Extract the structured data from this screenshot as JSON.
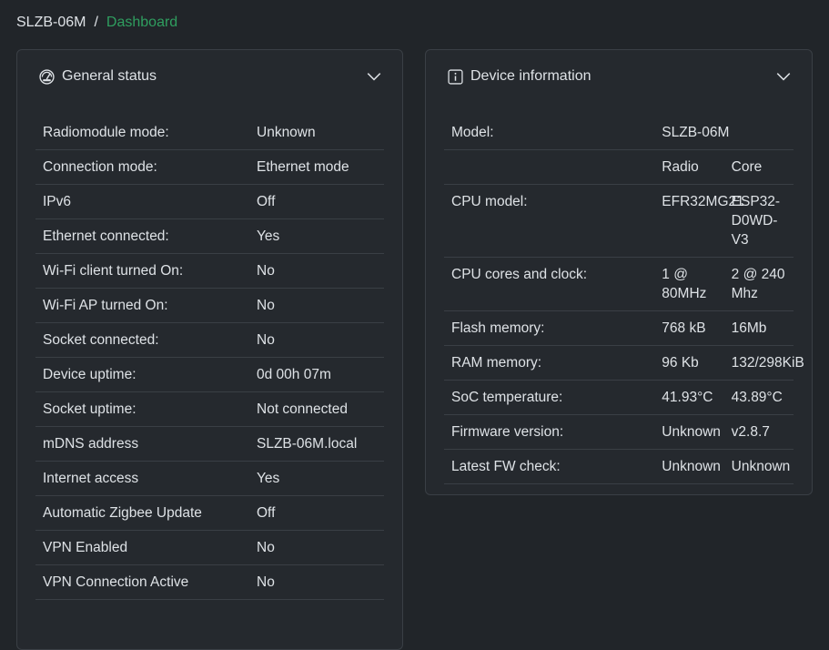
{
  "breadcrumb": {
    "device": "SLZB-06M",
    "separator": "/",
    "current": "Dashboard"
  },
  "general": {
    "title": "General status",
    "icon": "gauge-icon",
    "rows": [
      {
        "label": "Radiomodule mode:",
        "value": "Unknown"
      },
      {
        "label": "Connection mode:",
        "value": "Ethernet mode"
      },
      {
        "label": "IPv6",
        "value": "Off"
      },
      {
        "label": "Ethernet connected:",
        "value": "Yes"
      },
      {
        "label": "Wi-Fi client turned On:",
        "value": "No"
      },
      {
        "label": "Wi-Fi AP turned On:",
        "value": "No"
      },
      {
        "label": "Socket connected:",
        "value": "No"
      },
      {
        "label": "Device uptime:",
        "value": "0d 00h 07m"
      },
      {
        "label": "Socket uptime:",
        "value": "Not connected"
      },
      {
        "label": "mDNS address",
        "value": "SLZB-06M.local"
      },
      {
        "label": "Internet access",
        "value": "Yes"
      },
      {
        "label": "Automatic Zigbee Update",
        "value": "Off"
      },
      {
        "label": "VPN Enabled",
        "value": "No"
      },
      {
        "label": "VPN Connection Active",
        "value": "No"
      }
    ]
  },
  "device": {
    "title": "Device information",
    "icon": "info-icon",
    "model_label": "Model:",
    "model_value": "SLZB-06M",
    "col_radio": "Radio",
    "col_core": "Core",
    "rows": [
      {
        "label": "CPU model:",
        "radio": "EFR32MG21",
        "core": "ESP32-D0WD-V3"
      },
      {
        "label": "CPU cores and clock:",
        "radio": "1 @ 80MHz",
        "core": "2 @ 240 Mhz"
      },
      {
        "label": "Flash memory:",
        "radio": "768 kB",
        "core": "16Mb"
      },
      {
        "label": "RAM memory:",
        "radio": "96 Kb",
        "core": "132/298KiB"
      },
      {
        "label": "SoC temperature:",
        "radio": "41.93°C",
        "core": "43.89°C"
      },
      {
        "label": "Firmware version:",
        "radio": "Unknown",
        "core": "v2.8.7"
      },
      {
        "label": "Latest FW check:",
        "radio": "Unknown",
        "core": "Unknown"
      }
    ]
  },
  "colors": {
    "background": "#212529",
    "card": "#25292e",
    "accent": "#2f9e5f",
    "border": "#3a3f45"
  }
}
